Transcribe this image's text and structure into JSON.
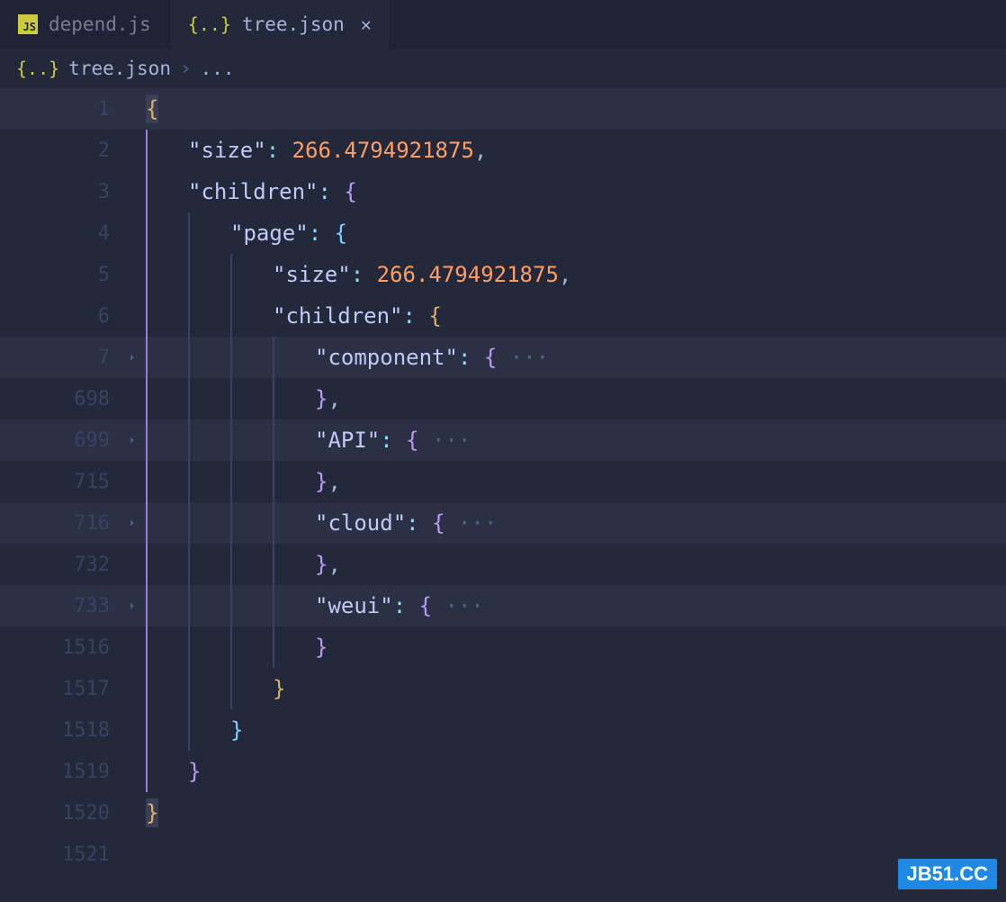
{
  "tabs": [
    {
      "icon": "js",
      "label": "depend.js",
      "active": false,
      "closeable": false
    },
    {
      "icon": "json",
      "label": "tree.json",
      "active": true,
      "closeable": true
    }
  ],
  "breadcrumb": {
    "icon": "json",
    "file": "tree.json",
    "rest": "..."
  },
  "watermark": "JB51.CC",
  "lines": [
    {
      "num": "1",
      "fold": false,
      "indent": 0,
      "hl": true,
      "tokens": [
        {
          "cls": "p-yellow cursor-bg",
          "t": "{"
        }
      ]
    },
    {
      "num": "2",
      "fold": false,
      "indent": 1,
      "tokens": [
        {
          "cls": "key",
          "t": "\"size\""
        },
        {
          "cls": "punc",
          "t": ":"
        },
        {
          "cls": "",
          "t": " "
        },
        {
          "cls": "num",
          "t": "266.4794921875"
        },
        {
          "cls": "punc-gray",
          "t": ","
        }
      ]
    },
    {
      "num": "3",
      "fold": false,
      "indent": 1,
      "tokens": [
        {
          "cls": "key",
          "t": "\"children\""
        },
        {
          "cls": "punc",
          "t": ":"
        },
        {
          "cls": "",
          "t": " "
        },
        {
          "cls": "p-pink",
          "t": "{"
        }
      ]
    },
    {
      "num": "4",
      "fold": false,
      "indent": 2,
      "tokens": [
        {
          "cls": "key",
          "t": "\"page\""
        },
        {
          "cls": "punc",
          "t": ":"
        },
        {
          "cls": "",
          "t": " "
        },
        {
          "cls": "p-blue",
          "t": "{"
        }
      ]
    },
    {
      "num": "5",
      "fold": false,
      "indent": 3,
      "tokens": [
        {
          "cls": "key",
          "t": "\"size\""
        },
        {
          "cls": "punc",
          "t": ":"
        },
        {
          "cls": "",
          "t": " "
        },
        {
          "cls": "num",
          "t": "266.4794921875"
        },
        {
          "cls": "punc-gray",
          "t": ","
        }
      ]
    },
    {
      "num": "6",
      "fold": false,
      "indent": 3,
      "tokens": [
        {
          "cls": "key",
          "t": "\"children\""
        },
        {
          "cls": "punc",
          "t": ":"
        },
        {
          "cls": "",
          "t": " "
        },
        {
          "cls": "p-yellow",
          "t": "{"
        }
      ]
    },
    {
      "num": "7",
      "fold": true,
      "indent": 4,
      "hl": true,
      "tokens": [
        {
          "cls": "key",
          "t": "\"component\""
        },
        {
          "cls": "punc",
          "t": ":"
        },
        {
          "cls": "",
          "t": " "
        },
        {
          "cls": "p-pink",
          "t": "{"
        },
        {
          "cls": "dots",
          "t": " ···"
        }
      ]
    },
    {
      "num": "698",
      "fold": false,
      "indent": 4,
      "tokens": [
        {
          "cls": "p-pink",
          "t": "}"
        },
        {
          "cls": "punc-gray",
          "t": ","
        }
      ]
    },
    {
      "num": "699",
      "fold": true,
      "indent": 4,
      "hl": true,
      "tokens": [
        {
          "cls": "key",
          "t": "\"API\""
        },
        {
          "cls": "punc",
          "t": ":"
        },
        {
          "cls": "",
          "t": " "
        },
        {
          "cls": "p-pink",
          "t": "{"
        },
        {
          "cls": "dots",
          "t": " ···"
        }
      ]
    },
    {
      "num": "715",
      "fold": false,
      "indent": 4,
      "tokens": [
        {
          "cls": "p-pink",
          "t": "}"
        },
        {
          "cls": "punc-gray",
          "t": ","
        }
      ]
    },
    {
      "num": "716",
      "fold": true,
      "indent": 4,
      "hl": true,
      "tokens": [
        {
          "cls": "key",
          "t": "\"cloud\""
        },
        {
          "cls": "punc",
          "t": ":"
        },
        {
          "cls": "",
          "t": " "
        },
        {
          "cls": "p-pink",
          "t": "{"
        },
        {
          "cls": "dots",
          "t": " ···"
        }
      ]
    },
    {
      "num": "732",
      "fold": false,
      "indent": 4,
      "tokens": [
        {
          "cls": "p-pink",
          "t": "}"
        },
        {
          "cls": "punc-gray",
          "t": ","
        }
      ]
    },
    {
      "num": "733",
      "fold": true,
      "indent": 4,
      "hl": true,
      "tokens": [
        {
          "cls": "key",
          "t": "\"weui\""
        },
        {
          "cls": "punc",
          "t": ":"
        },
        {
          "cls": "",
          "t": " "
        },
        {
          "cls": "p-pink",
          "t": "{"
        },
        {
          "cls": "dots",
          "t": " ···"
        }
      ]
    },
    {
      "num": "1516",
      "fold": false,
      "indent": 4,
      "tokens": [
        {
          "cls": "p-pink",
          "t": "}"
        }
      ]
    },
    {
      "num": "1517",
      "fold": false,
      "indent": 3,
      "tokens": [
        {
          "cls": "p-yellow",
          "t": "}"
        }
      ]
    },
    {
      "num": "1518",
      "fold": false,
      "indent": 2,
      "tokens": [
        {
          "cls": "p-blue",
          "t": "}"
        }
      ]
    },
    {
      "num": "1519",
      "fold": false,
      "indent": 1,
      "tokens": [
        {
          "cls": "p-pink",
          "t": "}"
        }
      ]
    },
    {
      "num": "1520",
      "fold": false,
      "indent": 0,
      "tokens": [
        {
          "cls": "p-yellow cursor-bg",
          "t": "}"
        }
      ]
    },
    {
      "num": "1521",
      "fold": false,
      "indent": 0,
      "tokens": []
    }
  ]
}
